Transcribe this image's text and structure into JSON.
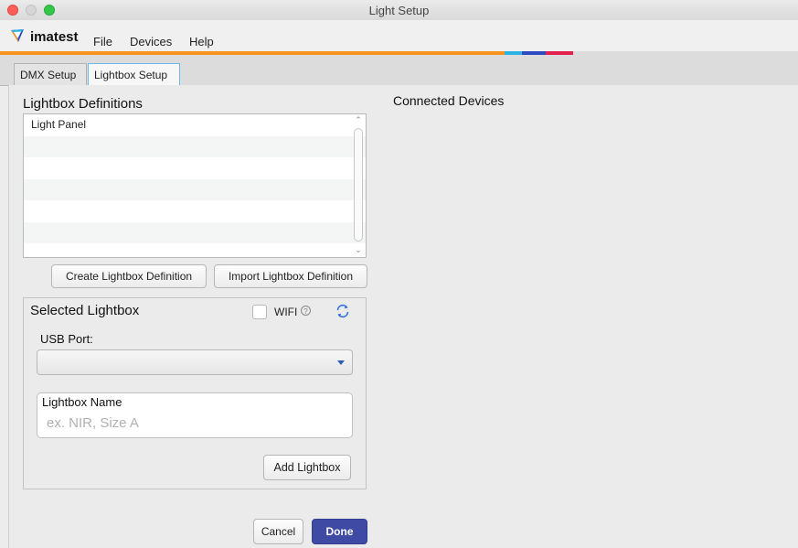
{
  "window": {
    "title": "Light Setup"
  },
  "menubar": {
    "brand": "imatest",
    "items": [
      "File",
      "Devices",
      "Help"
    ]
  },
  "tabs": [
    {
      "label": "DMX Setup",
      "active": false
    },
    {
      "label": "Lightbox Setup",
      "active": true
    }
  ],
  "left": {
    "definitions_title": "Lightbox Definitions",
    "definitions": [
      "Light Panel"
    ],
    "create_button": "Create Lightbox Definition",
    "import_button": "Import Lightbox Definition",
    "selected": {
      "title": "Selected Lightbox",
      "wifi_label": "WIFI",
      "wifi_checked": false,
      "usb_port_label": "USB Port:",
      "usb_port_value": "",
      "name_label": "Lightbox Name",
      "name_placeholder": "ex. NIR, Size A",
      "name_value": "",
      "add_button": "Add Lightbox"
    },
    "cancel_button": "Cancel",
    "done_button": "Done"
  },
  "right": {
    "title": "Connected Devices"
  },
  "icons": {
    "refresh": "refresh-icon",
    "help": "help-icon",
    "dropdown": "chevron-down-icon"
  },
  "colors": {
    "accent_orange": "#f7941d",
    "primary_button": "#3f4aa5",
    "tab_focus": "#6cb8e6",
    "refresh_icon": "#2f6fdd"
  }
}
